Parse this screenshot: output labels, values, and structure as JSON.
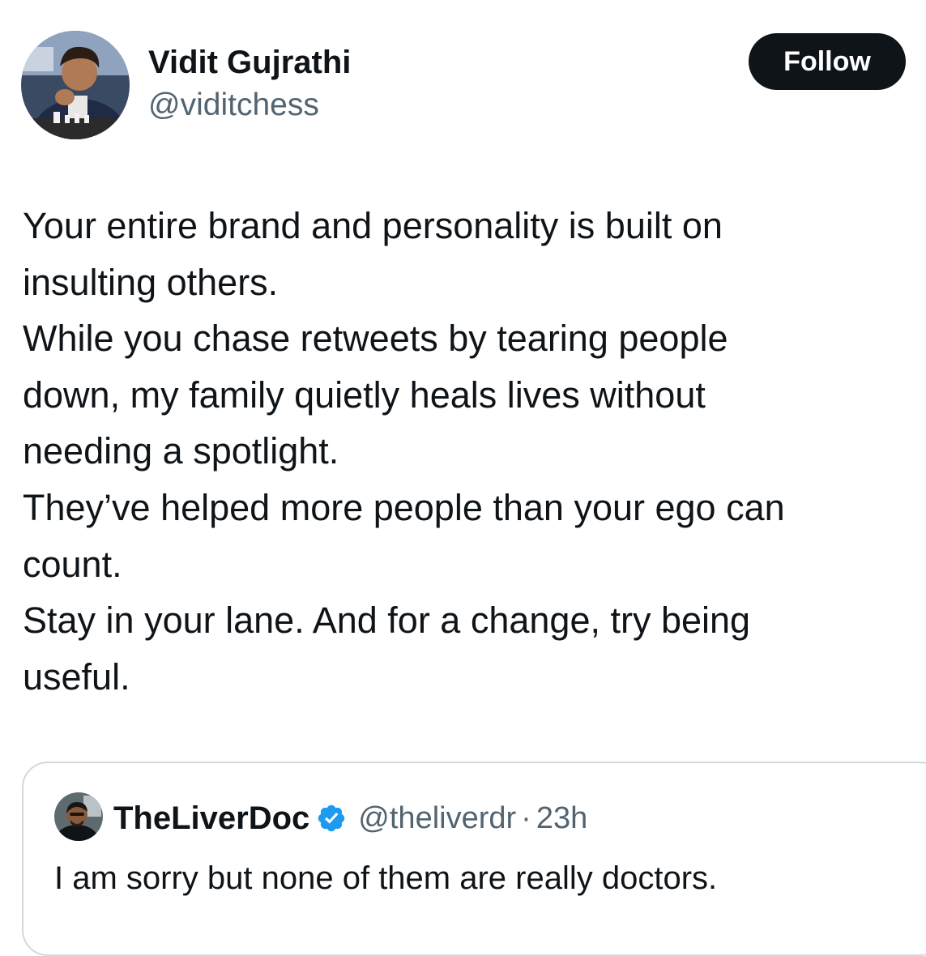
{
  "tweet": {
    "author_name": "Vidit Gujrathi",
    "author_handle": "@viditchess",
    "follow_label": "Follow",
    "lines": [
      "Your entire brand and personality is built on",
      "insulting others.",
      "While you chase retweets by tearing people",
      "down, my family quietly heals lives without",
      "needing a spotlight.",
      "They’ve helped more people than your ego can",
      "count.",
      "Stay in your lane. And for a change, try being",
      "useful."
    ]
  },
  "quote": {
    "author_name": "TheLiverDoc",
    "verified_icon": "verified-badge-icon",
    "author_handle": "@theliverdr",
    "separator": "·",
    "time": "23h",
    "text": "I am sorry but none of them are really doctors."
  },
  "colors": {
    "text_primary": "#0f1419",
    "text_secondary": "#536471",
    "follow_bg": "#0f1419",
    "verified_blue": "#1d9bf0",
    "card_border": "#cfd9de"
  }
}
